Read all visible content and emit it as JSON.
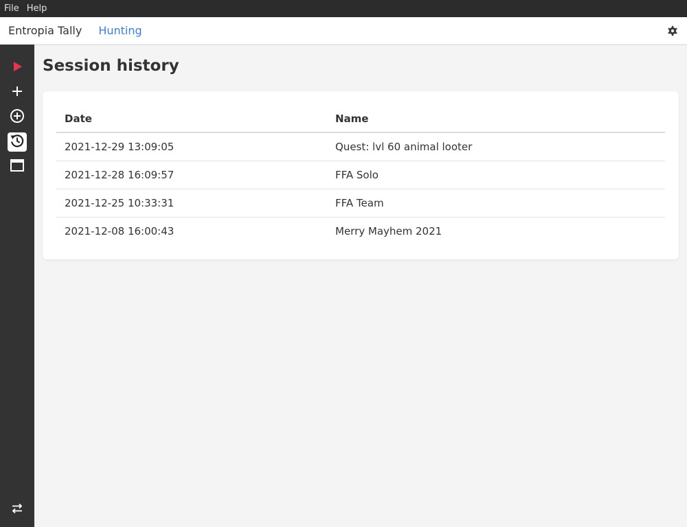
{
  "menubar": {
    "items": [
      "File",
      "Help"
    ]
  },
  "appbar": {
    "title": "Entropia Tally",
    "nav_link": "Hunting"
  },
  "sidebar": {
    "items": [
      {
        "icon": "play-icon",
        "color": "#e8344e"
      },
      {
        "icon": "plus-icon"
      },
      {
        "icon": "add-circle-icon"
      },
      {
        "icon": "history-icon",
        "active": true
      },
      {
        "icon": "window-icon"
      }
    ],
    "bottom_icon": "swap-icon"
  },
  "main": {
    "title": "Session history",
    "table": {
      "headers": [
        "Date",
        "Name"
      ],
      "rows": [
        {
          "date": "2021-12-29 13:09:05",
          "name": "Quest: lvl 60 animal looter"
        },
        {
          "date": "2021-12-28 16:09:57",
          "name": "FFA Solo"
        },
        {
          "date": "2021-12-25 10:33:31",
          "name": "FFA Team"
        },
        {
          "date": "2021-12-08 16:00:43",
          "name": "Merry Mayhem 2021"
        }
      ]
    }
  },
  "colors": {
    "accent": "#3d7fd9",
    "play": "#e8344e",
    "sidebar_bg": "#333333"
  }
}
